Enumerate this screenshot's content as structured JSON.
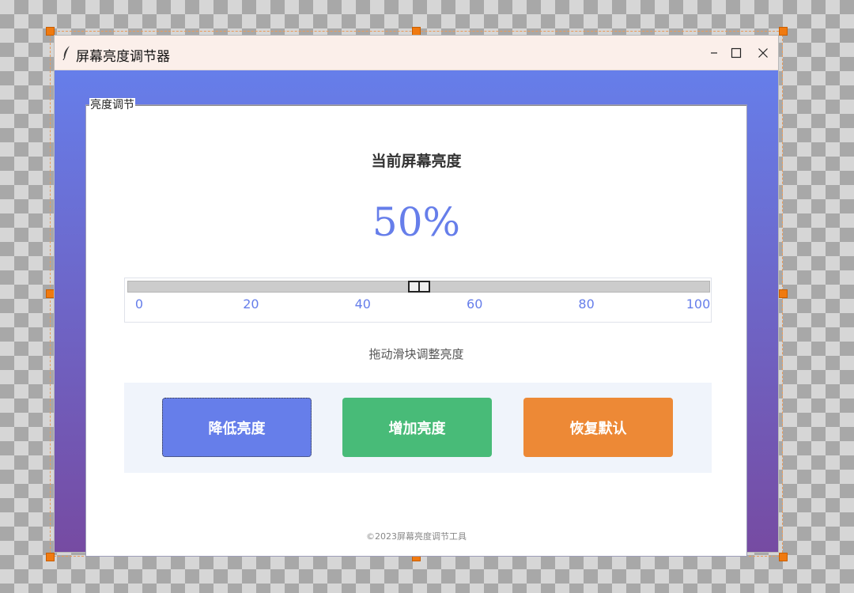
{
  "window": {
    "title": "屏幕亮度调节器",
    "icons": {
      "app": "feather-icon",
      "minimize": "minimize-icon",
      "maximize": "maximize-icon",
      "close": "close-icon"
    }
  },
  "panel": {
    "frame_label": "亮度调节",
    "heading": "当前屏幕亮度",
    "value_display": "50%",
    "brightness": 50,
    "slider": {
      "min": 0,
      "max": 100,
      "ticks": [
        "0",
        "20",
        "40",
        "60",
        "80",
        "100"
      ]
    },
    "hint": "拖动滑块调整亮度",
    "buttons": {
      "decrease": "降低亮度",
      "increase": "增加亮度",
      "reset": "恢复默认"
    },
    "footer": "©2023屏幕亮度调节工具"
  },
  "colors": {
    "accent": "#667eea",
    "gradient_start": "#667eea",
    "gradient_end": "#764ba2",
    "decrease_button": "#667eea",
    "increase_button": "#48bb78",
    "reset_button": "#ed8936",
    "button_area": "#f0f4fb",
    "selection_handle": "#f07a10"
  }
}
